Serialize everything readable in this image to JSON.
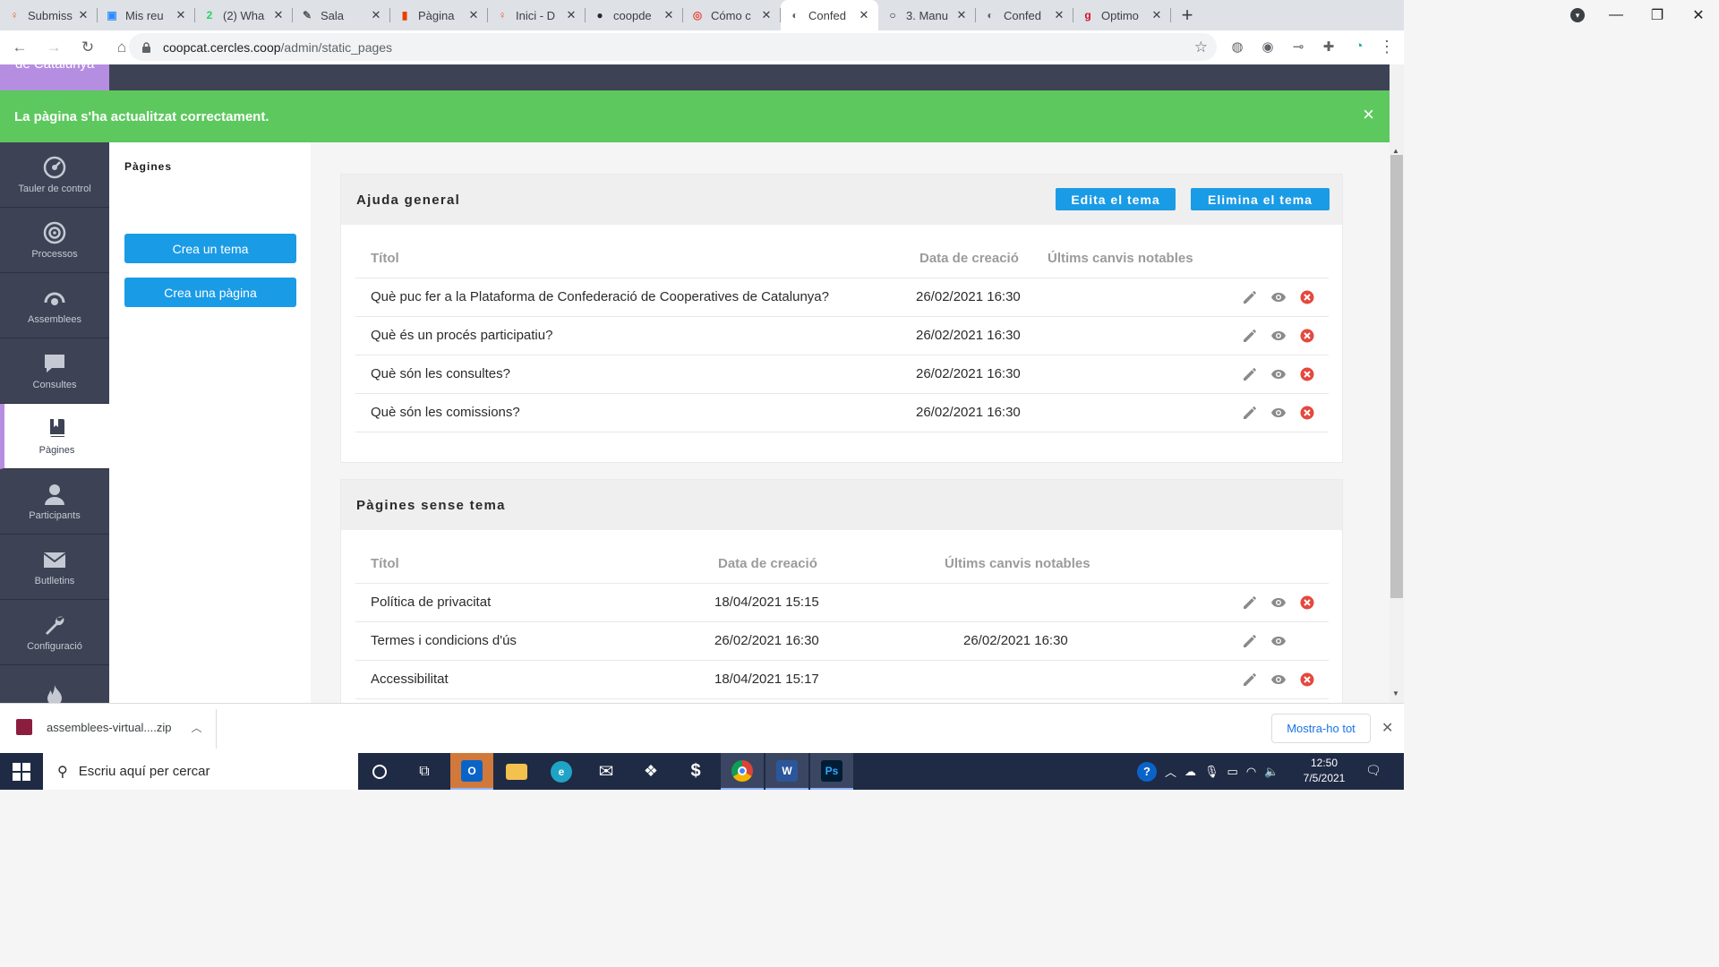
{
  "browser": {
    "tabs": [
      {
        "title": "Submiss",
        "icon": "person-icon",
        "color": "#f25c28",
        "active": false
      },
      {
        "title": "Mis reu",
        "icon": "zoom-icon",
        "color": "#2d8cff",
        "active": false
      },
      {
        "title": "(2) Wha",
        "icon": "whatsapp-icon",
        "color": "#25d366",
        "active": false
      },
      {
        "title": "Sala",
        "icon": "feather-icon",
        "color": "#555555",
        "active": false
      },
      {
        "title": "Pàgina",
        "icon": "office-icon",
        "color": "#eb3c00",
        "active": false
      },
      {
        "title": "Inici - D",
        "icon": "person-icon",
        "color": "#f25c28",
        "active": false
      },
      {
        "title": "coopde",
        "icon": "github-icon",
        "color": "#24292e",
        "active": false
      },
      {
        "title": "Cómo c",
        "icon": "target-icon",
        "color": "#e64a3c",
        "active": false
      },
      {
        "title": "Confed",
        "icon": "globe-icon",
        "color": "#5f6368",
        "active": true
      },
      {
        "title": "3. Manu",
        "icon": "circle-icon",
        "color": "#202124",
        "active": false
      },
      {
        "title": "Confed",
        "icon": "globe-icon",
        "color": "#5f6368",
        "active": false
      },
      {
        "title": "Optimo",
        "icon": "gencat-icon",
        "color": "#d0112b",
        "active": false
      }
    ],
    "url_host": "coopcat.cercles.coop",
    "url_path": "/admin/static_pages"
  },
  "app": {
    "logo_text": "de Catalunya",
    "accent": "#b68ee1",
    "primary": "#1a9be6"
  },
  "flash": {
    "message": "La pàgina s'ha actualitzat correctament.",
    "close": "×"
  },
  "sidebar": {
    "items": [
      {
        "label": "Tauler de control",
        "icon": "dashboard-icon",
        "active": false
      },
      {
        "label": "Processos",
        "icon": "target-icon",
        "active": false
      },
      {
        "label": "Assemblees",
        "icon": "assemblies-icon",
        "active": false
      },
      {
        "label": "Consultes",
        "icon": "speech-bubble-icon",
        "active": false
      },
      {
        "label": "Pàgines",
        "icon": "book-icon",
        "active": true
      },
      {
        "label": "Participants",
        "icon": "user-icon",
        "active": false
      },
      {
        "label": "Butlletins",
        "icon": "envelope-icon",
        "active": false
      },
      {
        "label": "Configuració",
        "icon": "wrench-icon",
        "active": false
      },
      {
        "label": "",
        "icon": "flame-icon",
        "active": false
      }
    ]
  },
  "subnav": {
    "title": "Pàgines",
    "create_topic": "Crea un tema",
    "create_page": "Crea una pàgina"
  },
  "topic": {
    "title": "Ajuda general",
    "edit_label": "Edita el tema",
    "delete_label": "Elimina el tema",
    "columns": [
      "Títol",
      "Data de creació",
      "Últims canvis notables"
    ],
    "rows": [
      {
        "title": "Què puc fer a la Plataforma de Confederació de Cooperatives de Catalunya?",
        "created": "26/02/2021 16:30",
        "changes": "",
        "deletable": true
      },
      {
        "title": "Què és un procés participatiu?",
        "created": "26/02/2021 16:30",
        "changes": "",
        "deletable": true
      },
      {
        "title": "Què són les consultes?",
        "created": "26/02/2021 16:30",
        "changes": "",
        "deletable": true
      },
      {
        "title": "Què són les comissions?",
        "created": "26/02/2021 16:30",
        "changes": "",
        "deletable": true
      }
    ]
  },
  "untopic": {
    "title": "Pàgines sense tema",
    "columns": [
      "Títol",
      "Data de creació",
      "Últims canvis notables"
    ],
    "rows": [
      {
        "title": "Política de privacitat",
        "created": "18/04/2021 15:15",
        "changes": "",
        "deletable": true
      },
      {
        "title": "Termes i condicions d'ús",
        "created": "26/02/2021 16:30",
        "changes": "26/02/2021 16:30",
        "deletable": false
      },
      {
        "title": "Accessibilitat",
        "created": "18/04/2021 15:17",
        "changes": "",
        "deletable": true
      }
    ]
  },
  "download": {
    "filename": "assemblees-virtual....zip",
    "show_all": "Mostra-ho tot"
  },
  "taskbar": {
    "search_placeholder": "Escriu aquí per cercar",
    "time": "12:50",
    "date": "7/5/2021"
  }
}
